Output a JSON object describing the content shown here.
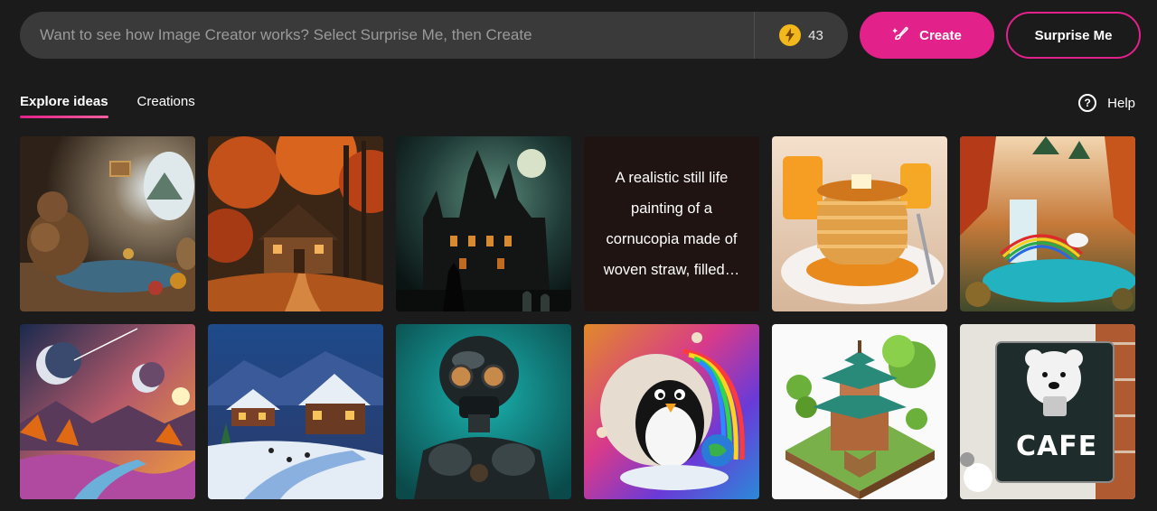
{
  "search": {
    "placeholder": "Want to see how Image Creator works? Select Surprise Me, then Create",
    "boost_icon": "lightning-bolt-icon",
    "boost_count": "43"
  },
  "buttons": {
    "create": "Create",
    "surprise": "Surprise Me"
  },
  "tabs": [
    {
      "label": "Explore ideas",
      "active": true
    },
    {
      "label": "Creations",
      "active": false
    }
  ],
  "help": {
    "label": "Help"
  },
  "gallery": {
    "text_tile": "A realistic still life painting of a cornucopia made of woven straw, filled…",
    "cafe_sign": "CAFE"
  },
  "colors": {
    "accent": "#e3218a",
    "background": "#1b1b1b",
    "input_bg": "#3a3a3a",
    "boost": "#f2b81c"
  }
}
